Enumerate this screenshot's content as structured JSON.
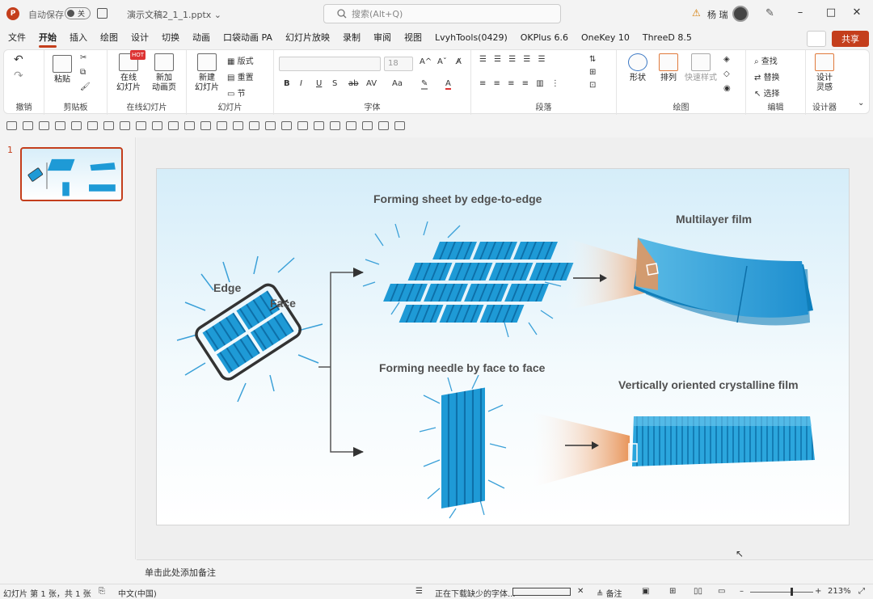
{
  "titlebar": {
    "logo_letter": "P",
    "autosave_label": "自动保存",
    "autosave_state": "关",
    "file_name": "演示文稿2_1_1.pptx ⌄",
    "search_placeholder": "搜索(Alt+Q)",
    "user_name": "杨 瑞"
  },
  "menu": {
    "tabs": [
      "文件",
      "开始",
      "插入",
      "绘图",
      "设计",
      "切换",
      "动画",
      "口袋动画 PA",
      "幻灯片放映",
      "录制",
      "审阅",
      "视图",
      "LvyhTools(0429)",
      "OKPlus 6.6",
      "OneKey 10",
      "ThreeD 8.5"
    ],
    "active_tab": "开始",
    "share_label": "共享"
  },
  "ribbon": {
    "undo_group": "撤销",
    "clipboard_group": "剪贴板",
    "paste_label": "粘贴",
    "online_group": "在线幻灯片",
    "online_slide_label": "在线\n幻灯片",
    "new_anim_label": "新加\n动画页",
    "hot_badge": "HOT",
    "slides_group": "幻灯片",
    "new_slide_label": "新建\n幻灯片",
    "layout_label": "版式",
    "reset_label": "重置",
    "section_label": "节",
    "font_group": "字体",
    "font_size": "18",
    "paragraph_group": "段落",
    "drawing_group": "绘图",
    "shapes_label": "形状",
    "arrange_label": "排列",
    "quick_style_label": "快速样式",
    "editing_group": "编辑",
    "find_label": "查找",
    "replace_label": "替换",
    "select_label": "选择",
    "designer_group": "设计器",
    "designer_label": "设计\n灵感"
  },
  "thumbnails": [
    {
      "number": "1"
    }
  ],
  "slide": {
    "edge_label": "Edge",
    "face_label": "Face",
    "sheet_title": "Forming sheet by edge-to-edge",
    "multilayer_title": "Multilayer film",
    "needle_title": "Forming needle by face to face",
    "vertical_title": "Vertically oriented crystalline film",
    "accent_blue": "#1e9ad6",
    "accent_orange": "#e8955a"
  },
  "notes": {
    "placeholder": "单击此处添加备注"
  },
  "status": {
    "slide_info": "幻灯片 第 1 张，共 1 张",
    "language": "中文(中国)",
    "download_text": "正在下载缺少的字体...",
    "notes_label": "备注",
    "zoom": "213%"
  }
}
